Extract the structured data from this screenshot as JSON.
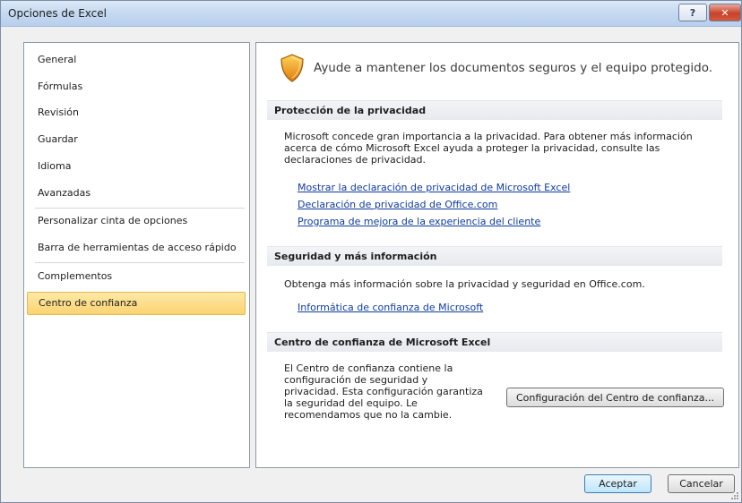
{
  "window": {
    "title": "Opciones de Excel",
    "help_label": "?",
    "close_label": "✕"
  },
  "nav": {
    "items": [
      {
        "label": "General",
        "selected": false
      },
      {
        "label": "Fórmulas",
        "selected": false
      },
      {
        "label": "Revisión",
        "selected": false
      },
      {
        "label": "Guardar",
        "selected": false
      },
      {
        "label": "Idioma",
        "selected": false
      },
      {
        "label": "Avanzadas",
        "selected": false
      },
      {
        "label": "Personalizar cinta de opciones",
        "selected": false
      },
      {
        "label": "Barra de herramientas de acceso rápido",
        "selected": false
      },
      {
        "label": "Complementos",
        "selected": false
      },
      {
        "label": "Centro de confianza",
        "selected": true
      }
    ]
  },
  "content": {
    "headline": "Ayude a mantener los documentos seguros y el equipo protegido.",
    "privacy": {
      "header": "Protección de la privacidad",
      "text_line1": "Microsoft concede gran importancia a la privacidad. Para obtener más información",
      "text_line2": "acerca de cómo Microsoft Excel ayuda a proteger la privacidad, consulte las",
      "text_line3": "declaraciones de privacidad.",
      "links": [
        "Mostrar la declaración de privacidad de Microsoft Excel",
        "Declaración de privacidad de Office.com",
        "Programa de mejora de la experiencia del cliente"
      ]
    },
    "security": {
      "header": "Seguridad y más información",
      "text": "Obtenga más información sobre la privacidad y seguridad en Office.com.",
      "link": "Informática de confianza de Microsoft"
    },
    "trust_center": {
      "header": "Centro de confianza de Microsoft Excel",
      "text_lines": [
        "El Centro de confianza contiene la",
        "configuración de seguridad y",
        "privacidad. Esta configuración garantiza",
        "la seguridad del equipo. Le",
        "recomendamos que no la cambie."
      ],
      "button_label": "Configuración del Centro de confianza..."
    }
  },
  "footer": {
    "ok_label": "Aceptar",
    "cancel_label": "Cancelar"
  },
  "colors": {
    "selected_bg": "#fbd372",
    "link": "#0f3c9c"
  }
}
